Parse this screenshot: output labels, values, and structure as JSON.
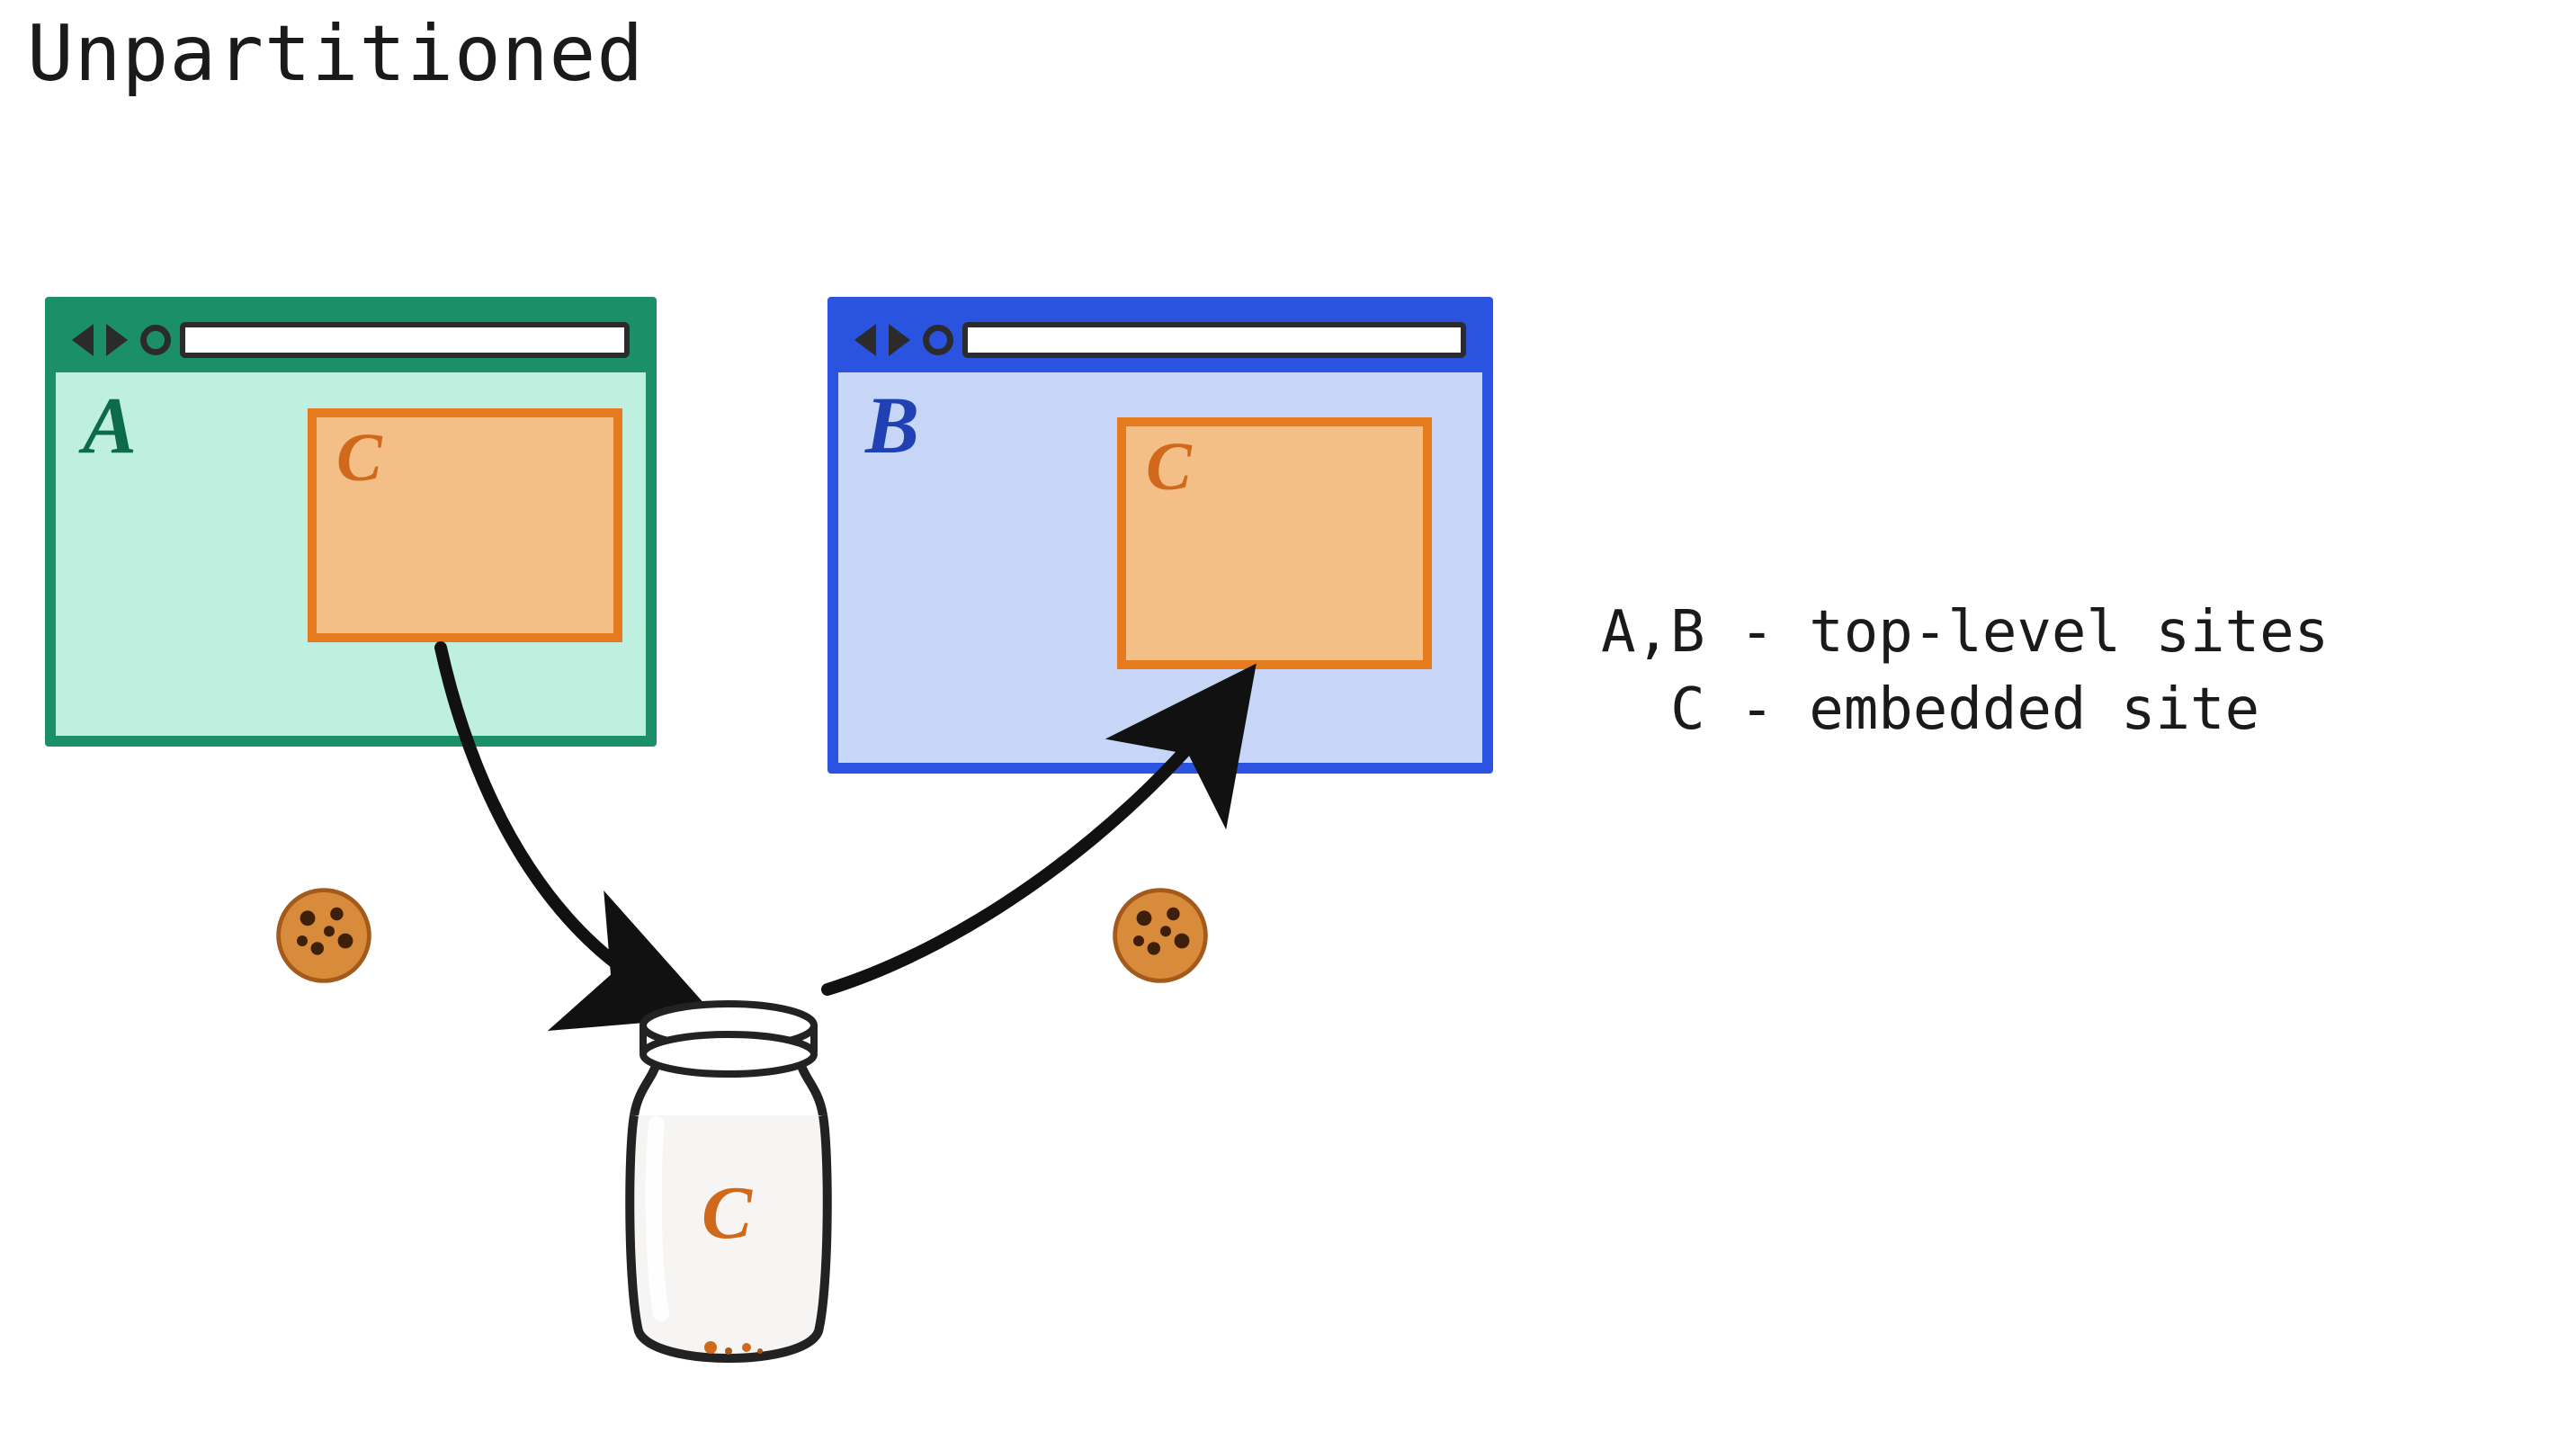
{
  "title": "Unpartitioned",
  "legend": {
    "line1": "A,B - top-level sites",
    "line2": "  C - embedded site"
  },
  "sites": {
    "a": {
      "label": "A",
      "role": "top-level"
    },
    "b": {
      "label": "B",
      "role": "top-level"
    },
    "c": {
      "label": "C",
      "role": "embedded"
    }
  },
  "jar": {
    "label": "C"
  },
  "icons": {
    "cookie": "cookie-icon",
    "back": "back-icon",
    "forward": "forward-icon",
    "reload": "reload-icon"
  },
  "colors": {
    "site_a_border": "#1b8f67",
    "site_a_fill": "#bff0df",
    "site_b_border": "#2a53e0",
    "site_b_fill": "#c7d6f7",
    "embed_border": "#e57a1f",
    "embed_fill": "#f4bf86",
    "ink": "#1a1a1a"
  },
  "arrows": [
    {
      "from": "embed-in-A",
      "to": "jar-C",
      "meaning": "set cookie"
    },
    {
      "from": "jar-C",
      "to": "embed-in-B",
      "meaning": "read cookie"
    }
  ]
}
